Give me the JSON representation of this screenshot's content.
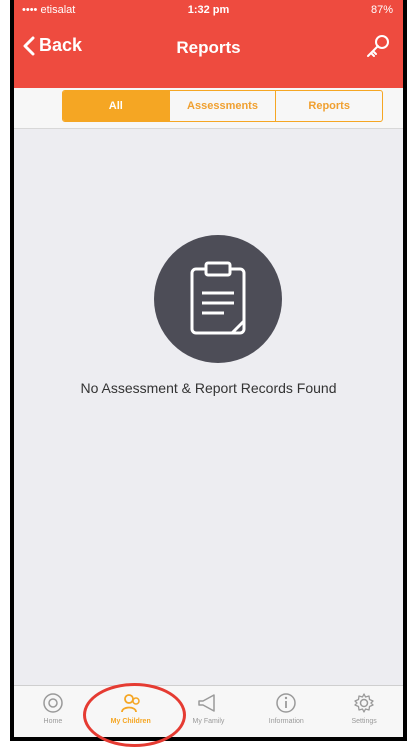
{
  "status_bar": {
    "carrier": "•••• etisalat",
    "time": "1:32 pm",
    "battery": "87%"
  },
  "nav": {
    "back_label": "Back",
    "title": "Reports",
    "key_icon": "key-icon"
  },
  "segments": [
    {
      "label": "All",
      "active": true
    },
    {
      "label": "Assessments",
      "active": false
    },
    {
      "label": "Reports",
      "active": false
    }
  ],
  "empty_state": {
    "icon": "clipboard-icon",
    "message": "No Assessment & Report Records Found"
  },
  "tabbar": [
    {
      "label": "Home",
      "icon": "home-icon",
      "active": false
    },
    {
      "label": "My Children",
      "icon": "children-icon",
      "active": true
    },
    {
      "label": "My Family",
      "icon": "megaphone-icon",
      "active": false
    },
    {
      "label": "Information",
      "icon": "info-icon",
      "active": false
    },
    {
      "label": "Settings",
      "icon": "gear-icon",
      "active": false
    }
  ],
  "colors": {
    "header": "#ee4b3f",
    "accent": "#f5a623",
    "icon_circle": "#4d4d57",
    "background": "#ededf1"
  }
}
